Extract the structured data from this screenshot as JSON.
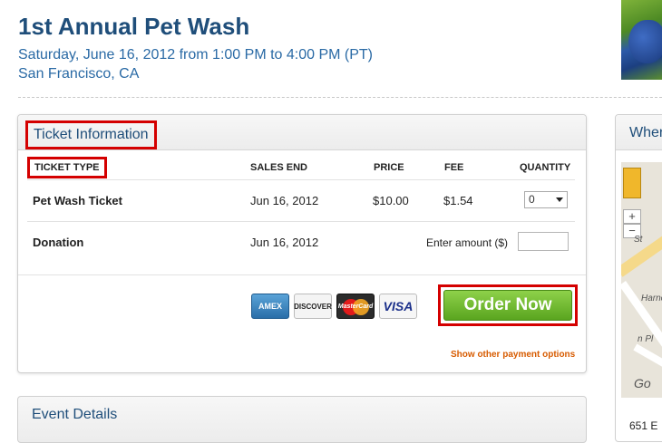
{
  "event": {
    "title": "1st Annual Pet Wash",
    "date_line": "Saturday, June 16, 2012 from 1:00 PM to 4:00 PM (PT)",
    "location": "San Francisco, CA"
  },
  "tickets": {
    "heading": "Ticket Information",
    "columns": {
      "type": "TICKET TYPE",
      "sales_end": "SALES END",
      "price": "PRICE",
      "fee": "FEE",
      "quantity": "QUANTITY"
    },
    "rows": [
      {
        "name": "Pet Wash Ticket",
        "sales_end": "Jun 16, 2012",
        "price": "$10.00",
        "fee": "$1.54",
        "quantity": "0"
      },
      {
        "name": "Donation",
        "sales_end": "Jun 16, 2012",
        "amount_label": "Enter amount ($)"
      }
    ],
    "payment_cards": [
      "AMEX",
      "DISCOVER",
      "MasterCard",
      "VISA"
    ],
    "order_button": "Order Now",
    "other_payment_link": "Show other payment options"
  },
  "event_details": {
    "heading": "Event Details"
  },
  "sidebar": {
    "heading": "Wher",
    "address": "651 E",
    "map_labels": [
      "St",
      "Harne",
      "n Pl",
      "Go"
    ]
  },
  "colors": {
    "heading_blue": "#1f4e7a",
    "link_blue": "#2a6aa5",
    "highlight_red": "#d40000",
    "button_green": "#6bb82e",
    "link_orange": "#d75b00"
  }
}
